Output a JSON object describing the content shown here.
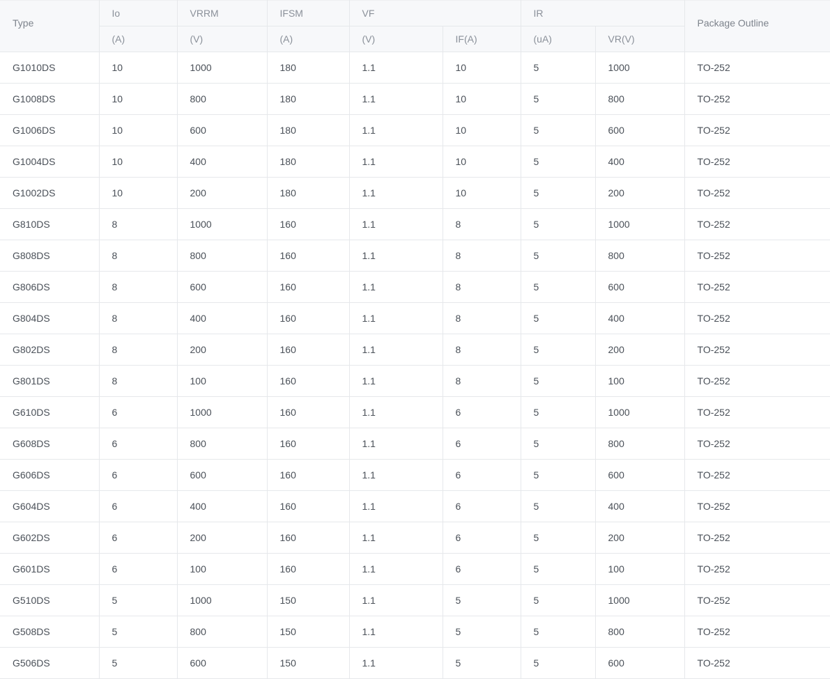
{
  "headers": {
    "type": "Type",
    "io": "Io",
    "vrrm": "VRRM",
    "ifsm": "IFSM",
    "vf": "VF",
    "ir": "IR",
    "package": "Package Outline",
    "units": {
      "io": "(A)",
      "vrrm": "(V)",
      "ifsm": "(A)",
      "vf": "(V)",
      "if": "IF(A)",
      "ir": "(uA)",
      "vr": "VR(V)"
    }
  },
  "rows": [
    [
      "G1010DS",
      "10",
      "1000",
      "180",
      "1.1",
      "10",
      "5",
      "1000",
      "TO-252"
    ],
    [
      "G1008DS",
      "10",
      "800",
      "180",
      "1.1",
      "10",
      "5",
      "800",
      "TO-252"
    ],
    [
      "G1006DS",
      "10",
      "600",
      "180",
      "1.1",
      "10",
      "5",
      "600",
      "TO-252"
    ],
    [
      "G1004DS",
      "10",
      "400",
      "180",
      "1.1",
      "10",
      "5",
      "400",
      "TO-252"
    ],
    [
      "G1002DS",
      "10",
      "200",
      "180",
      "1.1",
      "10",
      "5",
      "200",
      "TO-252"
    ],
    [
      "G810DS",
      "8",
      "1000",
      "160",
      "1.1",
      "8",
      "5",
      "1000",
      "TO-252"
    ],
    [
      "G808DS",
      "8",
      "800",
      "160",
      "1.1",
      "8",
      "5",
      "800",
      "TO-252"
    ],
    [
      "G806DS",
      "8",
      "600",
      "160",
      "1.1",
      "8",
      "5",
      "600",
      "TO-252"
    ],
    [
      "G804DS",
      "8",
      "400",
      "160",
      "1.1",
      "8",
      "5",
      "400",
      "TO-252"
    ],
    [
      "G802DS",
      "8",
      "200",
      "160",
      "1.1",
      "8",
      "5",
      "200",
      "TO-252"
    ],
    [
      "G801DS",
      "8",
      "100",
      "160",
      "1.1",
      "8",
      "5",
      "100",
      "TO-252"
    ],
    [
      "G610DS",
      "6",
      "1000",
      "160",
      "1.1",
      "6",
      "5",
      "1000",
      "TO-252"
    ],
    [
      "G608DS",
      "6",
      "800",
      "160",
      "1.1",
      "6",
      "5",
      "800",
      "TO-252"
    ],
    [
      "G606DS",
      "6",
      "600",
      "160",
      "1.1",
      "6",
      "5",
      "600",
      "TO-252"
    ],
    [
      "G604DS",
      "6",
      "400",
      "160",
      "1.1",
      "6",
      "5",
      "400",
      "TO-252"
    ],
    [
      "G602DS",
      "6",
      "200",
      "160",
      "1.1",
      "6",
      "5",
      "200",
      "TO-252"
    ],
    [
      "G601DS",
      "6",
      "100",
      "160",
      "1.1",
      "6",
      "5",
      "100",
      "TO-252"
    ],
    [
      "G510DS",
      "5",
      "1000",
      "150",
      "1.1",
      "5",
      "5",
      "1000",
      "TO-252"
    ],
    [
      "G508DS",
      "5",
      "800",
      "150",
      "1.1",
      "5",
      "5",
      "800",
      "TO-252"
    ],
    [
      "G506DS",
      "5",
      "600",
      "150",
      "1.1",
      "5",
      "5",
      "600",
      "TO-252"
    ]
  ]
}
